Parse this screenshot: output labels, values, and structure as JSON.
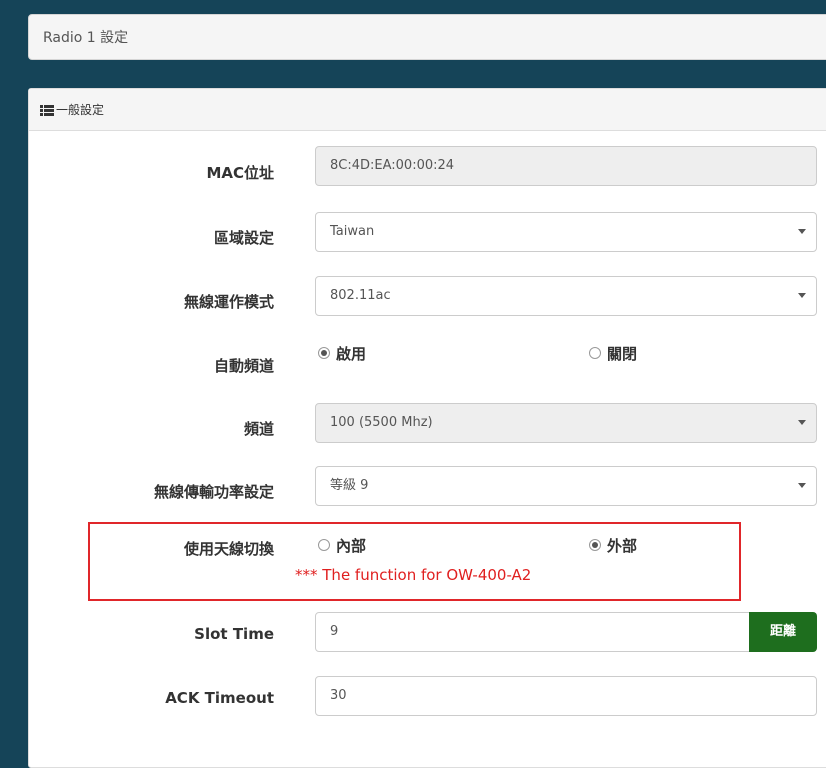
{
  "top_panel": {
    "title": "Radio 1 設定"
  },
  "section": {
    "heading": "一般設定",
    "icon": "list-icon"
  },
  "fields": {
    "mac": {
      "label": "MAC位址",
      "value": "8C:4D:EA:00:00:24"
    },
    "region": {
      "label": "區域設定",
      "value": "Taiwan"
    },
    "mode": {
      "label": "無線運作模式",
      "value": "802.11ac"
    },
    "auto_channel": {
      "label": "自動頻道",
      "options": [
        "啟用",
        "關閉"
      ],
      "selected": "啟用"
    },
    "channel": {
      "label": "頻道",
      "value": "100 (5500 Mhz)"
    },
    "tx_power": {
      "label": "無線傳輸功率設定",
      "value": "等級 9"
    },
    "antenna": {
      "label": "使用天線切換",
      "options": [
        "內部",
        "外部"
      ],
      "selected": "外部",
      "note": "*** The function for OW-400-A2"
    },
    "slot_time": {
      "label": "Slot Time",
      "value": "9",
      "button": "距離"
    },
    "ack_timeout": {
      "label": "ACK Timeout",
      "value": "30"
    }
  },
  "colors": {
    "background": "#154458",
    "accent_button": "#1e6e1e",
    "highlight_box": "#e0262a",
    "note_text": "#e02020"
  }
}
